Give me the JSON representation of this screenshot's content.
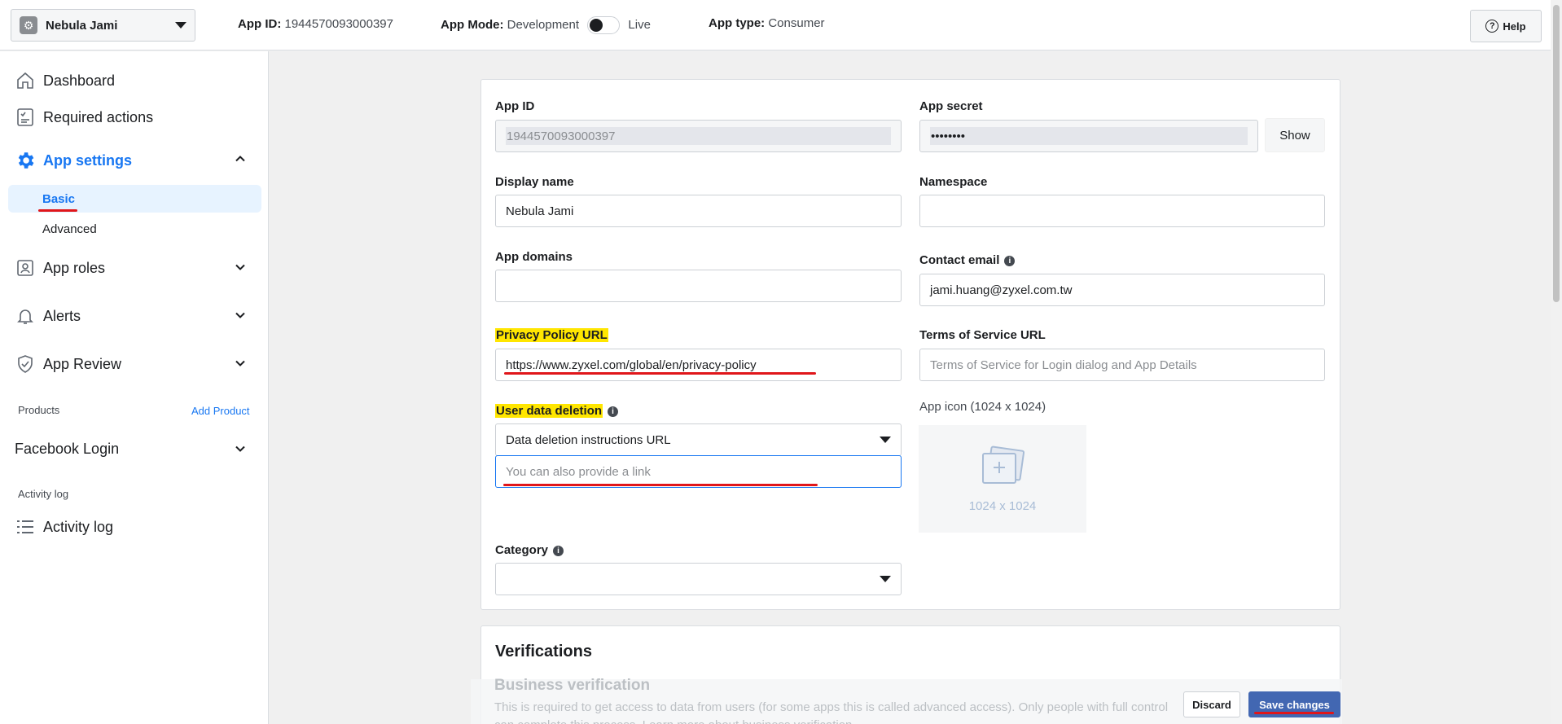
{
  "topbar": {
    "app_name": "Nebula Jami",
    "app_id_label": "App ID:",
    "app_id_value": "1944570093000397",
    "app_mode_label": "App Mode:",
    "app_mode_value": "Development",
    "app_mode_live": "Live",
    "app_type_label": "App type:",
    "app_type_value": "Consumer",
    "help_label": "Help"
  },
  "sidebar": {
    "dashboard": "Dashboard",
    "required_actions": "Required actions",
    "app_settings": "App settings",
    "basic": "Basic",
    "advanced": "Advanced",
    "app_roles": "App roles",
    "alerts": "Alerts",
    "app_review": "App Review",
    "products_label": "Products",
    "add_product": "Add Product",
    "facebook_login": "Facebook Login",
    "activity_log_section": "Activity log",
    "activity_log": "Activity log"
  },
  "form": {
    "app_id_label": "App ID",
    "app_id_value": "1944570093000397",
    "app_secret_label": "App secret",
    "app_secret_value": "••••••••",
    "show_label": "Show",
    "display_name_label": "Display name",
    "display_name_value": "Nebula Jami",
    "namespace_label": "Namespace",
    "namespace_value": "",
    "app_domains_label": "App domains",
    "app_domains_value": "",
    "contact_email_label": "Contact email",
    "contact_email_value": "jami.huang@zyxel.com.tw",
    "privacy_label": "Privacy Policy URL",
    "privacy_value": "https://www.zyxel.com/global/en/privacy-policy",
    "tos_label": "Terms of Service URL",
    "tos_placeholder": "Terms of Service for Login dialog and App Details",
    "user_data_label": "User data deletion",
    "user_data_select": "Data deletion instructions URL",
    "user_data_link_placeholder": "You can also provide a link",
    "app_icon_label": "App icon (1024 x 1024)",
    "app_icon_dim": "1024 x 1024",
    "category_label": "Category",
    "category_value": ""
  },
  "verifications": {
    "title": "Verifications",
    "business_title": "Business verification",
    "business_text": "This is required to get access to data from users (for some apps this is called advanced access). Only people with full control",
    "business_text2": "can complete this process. Learn more about business verification."
  },
  "footer": {
    "discard": "Discard",
    "save": "Save changes"
  },
  "colors": {
    "accent": "#1877f2",
    "highlight": "#ffe600",
    "annotation": "#e0161a",
    "save_button": "#4267b2"
  }
}
